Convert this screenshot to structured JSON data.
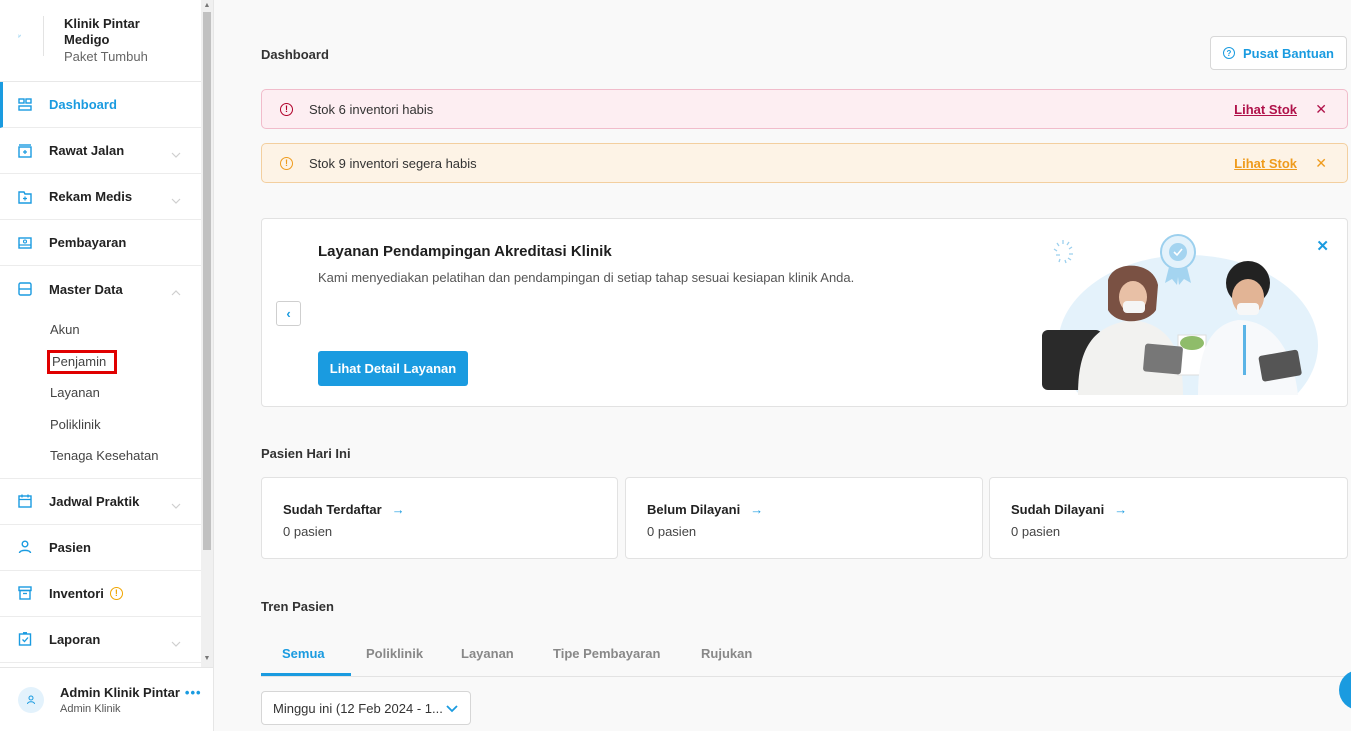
{
  "brand": {
    "name": "Klinik Pintar Medigo",
    "plan": "Paket Tumbuh",
    "logo_icon": "leaf-logo-icon"
  },
  "sidebar": {
    "items": [
      {
        "label": "Dashboard",
        "icon": "dashboard-icon",
        "active": true
      },
      {
        "label": "Rawat Jalan",
        "icon": "outpatient-icon"
      },
      {
        "label": "Rekam Medis",
        "icon": "medical-record-icon"
      },
      {
        "label": "Pembayaran",
        "icon": "payment-icon"
      },
      {
        "label": "Master Data",
        "icon": "master-data-icon",
        "expanded": true
      },
      {
        "label": "Jadwal Praktik",
        "icon": "calendar-icon"
      },
      {
        "label": "Pasien",
        "icon": "patient-icon"
      },
      {
        "label": "Inventori",
        "icon": "inventory-icon",
        "badge": "!"
      },
      {
        "label": "Laporan",
        "icon": "report-icon"
      }
    ],
    "master_data_sub": [
      "Akun",
      "Penjamin",
      "Layanan",
      "Poliklinik",
      "Tenaga Kesehatan"
    ]
  },
  "user": {
    "name": "Admin Klinik Pintar",
    "role": "Admin Klinik",
    "more": "•••"
  },
  "header": {
    "title": "Dashboard",
    "help_label": "Pusat Bantuan"
  },
  "alerts": [
    {
      "text": "Stok 6 inventori habis",
      "link": "Lihat Stok",
      "close": "✕",
      "color": "#b0124a"
    },
    {
      "text": "Stok 9 inventori segera habis",
      "link": "Lihat Stok",
      "close": "✕",
      "color": "#ef9b1d"
    }
  ],
  "banner": {
    "title": "Layanan Pendampingan Akreditasi Klinik",
    "description": "Kami menyediakan pelatihan dan pendampingan di setiap tahap sesuai kesiapan klinik Anda.",
    "cta": "Lihat Detail Layanan",
    "prev": "‹",
    "close": "✕"
  },
  "today": {
    "label": "Pasien Hari Ini",
    "cards": [
      {
        "title": "Sudah Terdaftar",
        "value": "0 pasien"
      },
      {
        "title": "Belum Dilayani",
        "value": "0 pasien"
      },
      {
        "title": "Sudah Dilayani",
        "value": "0 pasien"
      }
    ]
  },
  "trend": {
    "label": "Tren Pasien",
    "tabs": [
      "Semua",
      "Poliklinik",
      "Layanan",
      "Tipe Pembayaran",
      "Rujukan"
    ],
    "active_tab": "Semua",
    "range": "Minggu ini (12 Feb 2024 - 1..."
  },
  "colors": {
    "accent": "#1a9be0",
    "danger": "#b0124a",
    "warning": "#ef9b1d"
  }
}
